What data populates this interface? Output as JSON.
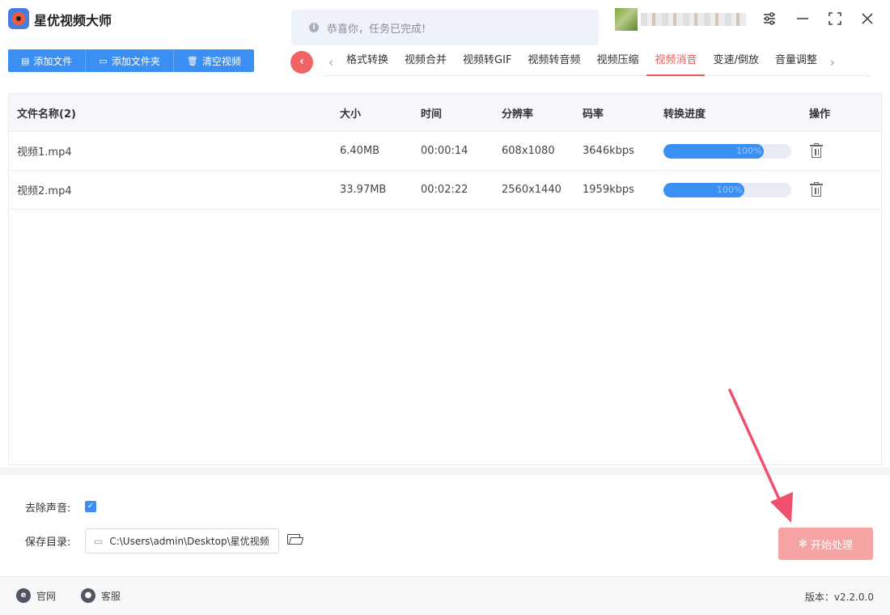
{
  "app": {
    "title": "星优视频大师"
  },
  "notice": {
    "text": "恭喜你，任务已完成!"
  },
  "toolbar": {
    "add_file": "添加文件",
    "add_folder": "添加文件夹",
    "clear_videos": "清空视频"
  },
  "tabs": [
    {
      "label": "格式转换"
    },
    {
      "label": "视频合并"
    },
    {
      "label": "视频转GIF"
    },
    {
      "label": "视频转音频"
    },
    {
      "label": "视频压缩"
    },
    {
      "label": "视频消音",
      "active": true
    },
    {
      "label": "变速/倒放"
    },
    {
      "label": "音量调整"
    }
  ],
  "table": {
    "headers": {
      "name": "文件名称(2)",
      "size": "大小",
      "time": "时间",
      "resolution": "分辨率",
      "bitrate": "码率",
      "progress": "转换进度",
      "action": "操作"
    },
    "rows": [
      {
        "name": "视频1.mp4",
        "size": "6.40MB",
        "time": "00:00:14",
        "resolution": "608x1080",
        "bitrate": "3646kbps",
        "progress_label": "100%",
        "progress": 1.0
      },
      {
        "name": "视频2.mp4",
        "size": "33.97MB",
        "time": "00:02:22",
        "resolution": "2560x1440",
        "bitrate": "1959kbps",
        "progress_label": "100%",
        "progress": 1.0
      }
    ]
  },
  "settings": {
    "remove_audio_label": "去除声音:",
    "remove_audio_checked": true,
    "save_dir_label": "保存目录:",
    "save_dir_value": "C:\\Users\\admin\\Desktop\\星优视频"
  },
  "start_button": {
    "label": "开始处理"
  },
  "footer": {
    "website": "官网",
    "support": "客服",
    "version": "版本：v2.2.0.0"
  },
  "colors": {
    "primary": "#3b8ff2",
    "accent_red": "#e85c5c",
    "start_button": "#f6a3a3",
    "arrow": "#f0506e"
  }
}
